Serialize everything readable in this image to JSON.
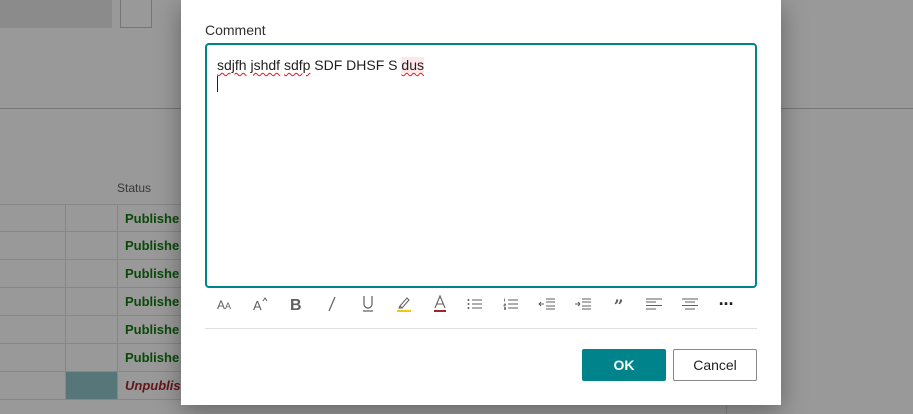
{
  "background": {
    "column_header": "Status",
    "rows": [
      {
        "status": "Publishe",
        "kind": "published"
      },
      {
        "status": "Publishe",
        "kind": "published"
      },
      {
        "status": "Publishe",
        "kind": "published"
      },
      {
        "status": "Publishe",
        "kind": "published"
      },
      {
        "status": "Publishe",
        "kind": "published"
      },
      {
        "status": "Publishe",
        "kind": "published"
      },
      {
        "status": "Unpublis",
        "kind": "unpublished",
        "selected": true
      }
    ]
  },
  "dialog": {
    "label": "Comment",
    "text_parts": {
      "w1": "sdjfh",
      "w2": "jshdf",
      "w3": "sdfp",
      "w4": "SDF DHSF S",
      "w5": "dus"
    },
    "toolbar": [
      {
        "name": "font-size-icon",
        "glyph": "AA"
      },
      {
        "name": "grow-font-icon",
        "glyph": "A^"
      },
      {
        "name": "bold-icon",
        "glyph": "B"
      },
      {
        "name": "italic-icon",
        "glyph": "/"
      },
      {
        "name": "underline-icon",
        "glyph": "U"
      },
      {
        "name": "highlight-icon",
        "glyph": "marker"
      },
      {
        "name": "font-color-icon",
        "glyph": "A"
      },
      {
        "name": "bullet-list-icon",
        "glyph": "bullets"
      },
      {
        "name": "numbered-list-icon",
        "glyph": "numbers"
      },
      {
        "name": "decrease-indent-icon",
        "glyph": "outdent"
      },
      {
        "name": "increase-indent-icon",
        "glyph": "indent"
      },
      {
        "name": "quote-icon",
        "glyph": "”"
      },
      {
        "name": "align-left-icon",
        "glyph": "left"
      },
      {
        "name": "align-center-icon",
        "glyph": "center"
      },
      {
        "name": "more-options-icon",
        "glyph": "···"
      }
    ],
    "ok_label": "OK",
    "cancel_label": "Cancel"
  },
  "colors": {
    "accent": "#00838a",
    "published": "#107c10",
    "unpublished": "#a4262c",
    "highlight_marker": "#f2c811",
    "font_color_bar": "#a4262c"
  }
}
